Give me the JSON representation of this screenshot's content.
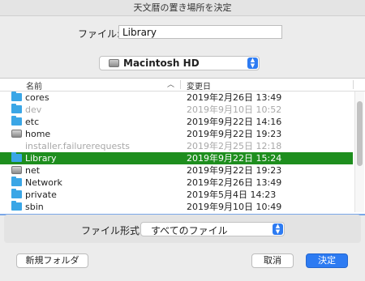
{
  "window": {
    "title": "天文暦の置き場所を決定"
  },
  "filename": {
    "label": "ファイル:",
    "value": "Library"
  },
  "location": {
    "selected": "Macintosh HD",
    "icon": "hard-disk-icon"
  },
  "columns": {
    "name": "名前",
    "date": "変更日"
  },
  "files": [
    {
      "name": "cores",
      "date": "2019年2月26日 13:49",
      "icon": "folder-icon",
      "dim": false,
      "selected": false
    },
    {
      "name": "dev",
      "date": "2019年9月10日 10:52",
      "icon": "folder-icon",
      "dim": true,
      "selected": false
    },
    {
      "name": "etc",
      "date": "2019年9月22日 14:16",
      "icon": "folder-icon",
      "dim": false,
      "selected": false
    },
    {
      "name": "home",
      "date": "2019年9月22日 19:23",
      "icon": "disk-icon",
      "dim": false,
      "selected": false
    },
    {
      "name": "installer.failurerequests",
      "date": "2019年2月25日 12:18",
      "icon": "file-icon",
      "dim": true,
      "selected": false
    },
    {
      "name": "Library",
      "date": "2019年9月22日 15:24",
      "icon": "folder-icon",
      "dim": false,
      "selected": true
    },
    {
      "name": "net",
      "date": "2019年9月22日 19:23",
      "icon": "disk-icon",
      "dim": false,
      "selected": false
    },
    {
      "name": "Network",
      "date": "2019年2月26日 13:49",
      "icon": "folder-icon",
      "dim": false,
      "selected": false
    },
    {
      "name": "private",
      "date": "2019年5月4日 14:23",
      "icon": "folder-icon",
      "dim": false,
      "selected": false
    },
    {
      "name": "sbin",
      "date": "2019年9月10日 10:49",
      "icon": "folder-icon",
      "dim": false,
      "selected": false
    }
  ],
  "format": {
    "label": "ファイル形式:",
    "selected": "すべてのファイル"
  },
  "buttons": {
    "new_folder": "新規フォルダ",
    "cancel": "取消",
    "ok": "決定"
  },
  "colors": {
    "selection": "#1e8e1e",
    "accent": "#2d7bf2"
  }
}
